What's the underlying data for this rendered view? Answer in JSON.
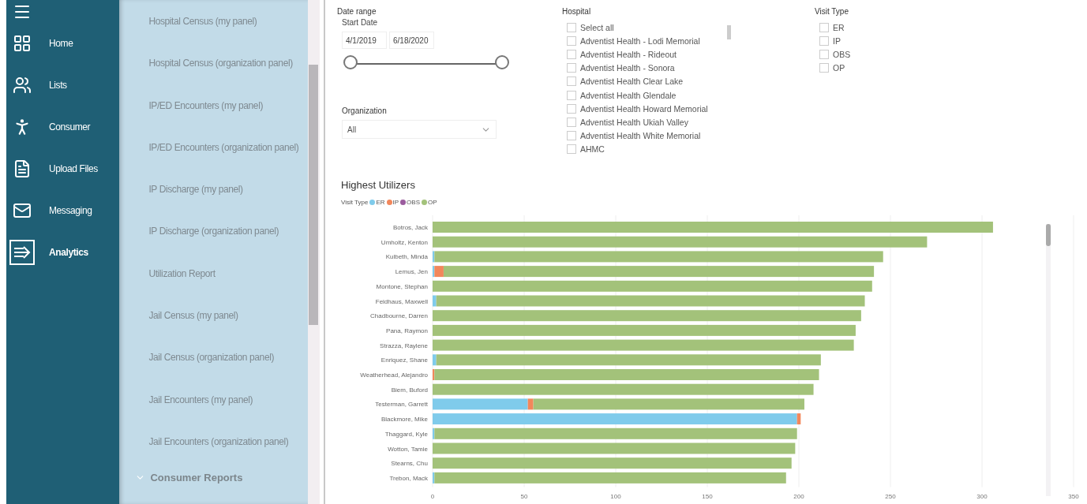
{
  "nav": {
    "items": [
      {
        "label": "Home",
        "selected": false
      },
      {
        "label": "Lists",
        "selected": false
      },
      {
        "label": "Consumer",
        "selected": false
      },
      {
        "label": "Upload Files",
        "selected": false
      },
      {
        "label": "Messaging",
        "selected": false
      },
      {
        "label": "Analytics",
        "selected": true
      }
    ]
  },
  "reports": {
    "items": [
      "Hospital Census (my panel)",
      "Hospital Census (organization panel)",
      "IP/ED Encounters (my panel)",
      "IP/ED Encounters (organization panel)",
      "IP Discharge (my panel)",
      "IP Discharge (organization panel)",
      "Utilization Report",
      "Jail Census (my panel)",
      "Jail Census (organization panel)",
      "Jail Encounters (my panel)",
      "Jail Encounters (organization panel)"
    ],
    "section": {
      "label": "Consumer Reports",
      "expanded": true
    }
  },
  "filters": {
    "date_range": {
      "label": "Date range",
      "sublabel": "Start Date",
      "start": "4/1/2019",
      "end": "6/18/2020",
      "level": 1
    },
    "organization": {
      "label": "Organization",
      "value": "All"
    },
    "hospital": {
      "label": "Hospital",
      "options": [
        {
          "label": "Select all",
          "checked": false
        },
        {
          "label": "Adventist Health - Lodi Memorial",
          "checked": false
        },
        {
          "label": "Adventist Health - Rideout",
          "checked": false
        },
        {
          "label": "Adventist Health - Sonora",
          "checked": false
        },
        {
          "label": "Adventist Health Clear Lake",
          "checked": false
        },
        {
          "label": "Adventist Health Glendale",
          "checked": false
        },
        {
          "label": "Adventist Health Howard Memorial",
          "checked": false
        },
        {
          "label": "Adventist Health Ukiah Valley",
          "checked": false
        },
        {
          "label": "Adventist Health White Memorial",
          "checked": false
        },
        {
          "label": "AHMC",
          "checked": false
        }
      ]
    },
    "visit_type": {
      "label": "Visit Type",
      "options": [
        {
          "label": "ER",
          "checked": false
        },
        {
          "label": "IP",
          "checked": false
        },
        {
          "label": "OBS",
          "checked": false
        },
        {
          "label": "OP",
          "checked": false
        }
      ]
    }
  },
  "chart": {
    "legend_title": "Visit Type",
    "chart_data": {
      "type": "bar",
      "orientation": "horizontal",
      "stacked": true,
      "title": "Highest Utilizers",
      "categories": [
        "Botros, Jack",
        "Umholtz, Kenton",
        "Kulbeth, Minda",
        "Lemus, Jen",
        "Montone, Stephan",
        "Feidhaus, Maxwell",
        "Chadbourne, Darren",
        "Pana, Raymon",
        "Strazza, Raylene",
        "Enriquez, Shane",
        "Weatherhead, Alejandro",
        "Biem, Buford",
        "Testerman, Garrett",
        "Blackmore, Mike",
        "Thaggard, Kyle",
        "Wotton, Tamie",
        "Stearns, Chu",
        "Trebon, Mack"
      ],
      "series": [
        {
          "name": "ER",
          "color": "#7fcbeb",
          "values": [
            0,
            0,
            1,
            1,
            0,
            2,
            0,
            0,
            0,
            2,
            0,
            0,
            52,
            199,
            1,
            0,
            0,
            1
          ]
        },
        {
          "name": "IP",
          "color": "#f2875b",
          "values": [
            0,
            0,
            0,
            5,
            0,
            0,
            0,
            0,
            0,
            0,
            1,
            0,
            3,
            2,
            0,
            0,
            0,
            0
          ]
        },
        {
          "name": "OBS",
          "color": "#9b5c9e",
          "values": [
            0,
            0,
            0,
            0,
            0,
            0,
            0,
            0,
            0,
            0,
            0,
            0,
            0,
            0,
            0,
            0,
            0,
            0
          ]
        },
        {
          "name": "OP",
          "color": "#a3c27a",
          "values": [
            306,
            270,
            245,
            235,
            240,
            234,
            234,
            231,
            230,
            210,
            210,
            208,
            148,
            0,
            198,
            198,
            196,
            192
          ]
        }
      ],
      "xlim": [
        0,
        350
      ],
      "grid": true,
      "xticks": [
        0,
        50,
        100,
        150,
        200,
        250,
        300,
        350
      ]
    }
  }
}
